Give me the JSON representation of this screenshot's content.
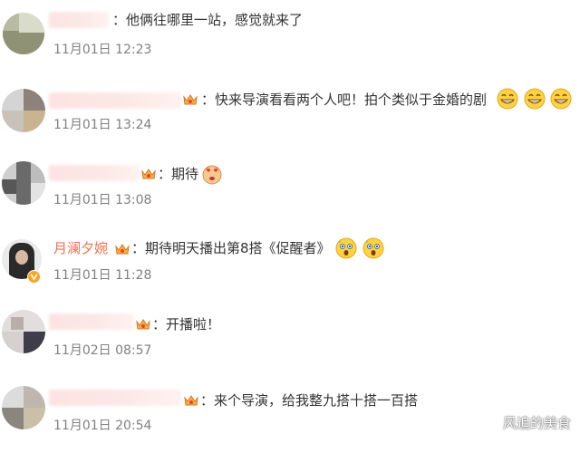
{
  "comments": [
    {
      "text": "：他俩往哪里一站，感觉就来了",
      "time": "11月01日 12:23"
    },
    {
      "text": "：快来导演看看两个人吧！拍个类似于金婚的剧",
      "time": "11月01日 13:24"
    },
    {
      "text": "：期待",
      "time": "11月01日 13:08"
    },
    {
      "name": "月澜夕婉",
      "text": "：期待明天播出第8搭《促醒者》",
      "time": "11月01日 11:28"
    },
    {
      "text": "：开播啦！",
      "time": "11月02日 08:57"
    },
    {
      "text": "：来个导演，给我整九搭十搭一百搭",
      "time": "11月01日 20:54"
    }
  ],
  "emoji_names": {
    "grin": "grin-emoji",
    "heart_eyes": "heart-eyes-emoji",
    "wow": "surprised-emoji"
  },
  "colors": {
    "name": "#eb7350",
    "time": "#808080",
    "text": "#333333"
  },
  "watermark": "风追的美食"
}
